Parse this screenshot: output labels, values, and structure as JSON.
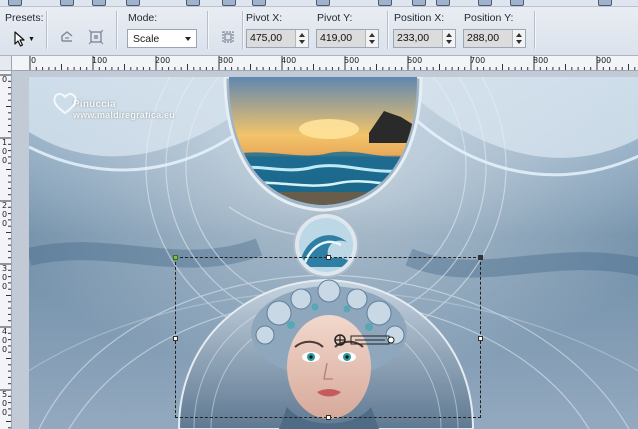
{
  "toolbar": {
    "presets_label": "Presets:",
    "mode_label": "Mode:",
    "mode_value": "Scale",
    "pivot_x_label": "Pivot X:",
    "pivot_x_value": "475,00",
    "pivot_y_label": "Pivot Y:",
    "pivot_y_value": "419,00",
    "position_x_label": "Position X:",
    "position_x_value": "233,00",
    "position_y_label": "Position Y:",
    "position_y_value": "288,00",
    "icons": [
      "arrow-pointer-icon",
      "reset-icon",
      "fit-to-canvas-icon",
      "align-icon"
    ]
  },
  "ruler": {
    "horizontal_labels": [
      "0",
      "100",
      "200",
      "300",
      "400",
      "500",
      "600",
      "700",
      "800",
      "900"
    ],
    "vertical_labels": [
      "0",
      "100",
      "200",
      "300",
      "400",
      "500"
    ]
  },
  "canvas": {
    "watermark_name": "Pinuccia",
    "watermark_url": "www.maldiregrafica.eu"
  },
  "colors": {
    "accent": "#5b8fb8",
    "deep_blue": "#1f3f5e",
    "sunset": "#f3c46a",
    "pivot_green": "#7ac142"
  }
}
